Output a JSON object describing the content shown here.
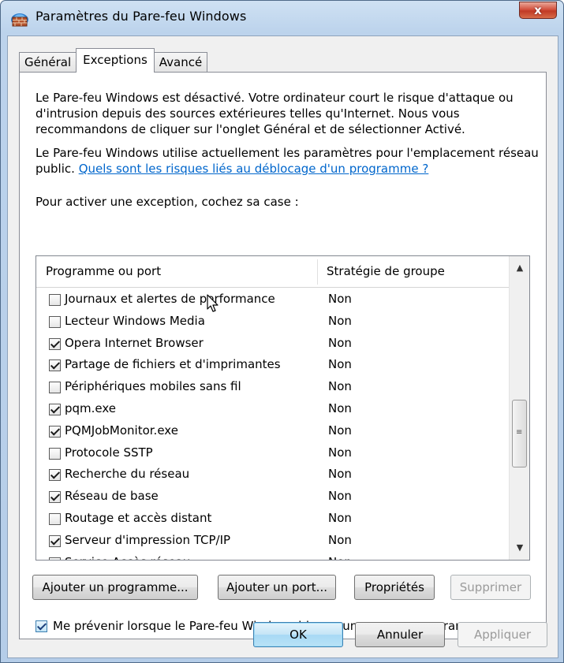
{
  "window": {
    "title": "Paramètres du Pare-feu Windows",
    "close_label": "x"
  },
  "tabs": [
    {
      "label": "Général",
      "active": false
    },
    {
      "label": "Exceptions",
      "active": true
    },
    {
      "label": "Avancé",
      "active": false
    }
  ],
  "info": {
    "warning": "Le Pare-feu Windows est désactivé. Votre ordinateur court le risque d'attaque ou d'intrusion depuis des sources extérieures telles qu'Internet. Nous vous recommandons de cliquer sur l'onglet Général et de sélectionner Activé.",
    "location_text": "Le Pare-feu Windows utilise actuellement les paramètres pour l'emplacement réseau public.",
    "risk_link": "Quels sont les risques liés au déblocage d'un programme ?",
    "instruction": "Pour activer une exception, cochez sa case :"
  },
  "list": {
    "col_program": "Programme ou port",
    "col_policy": "Stratégie de groupe",
    "rows": [
      {
        "label": "Journaux et alertes de performance",
        "checked": false,
        "policy": "Non"
      },
      {
        "label": "Lecteur Windows Media",
        "checked": false,
        "policy": "Non"
      },
      {
        "label": "Opera Internet Browser",
        "checked": true,
        "policy": "Non"
      },
      {
        "label": "Partage de fichiers et d'imprimantes",
        "checked": true,
        "policy": "Non"
      },
      {
        "label": "Périphériques mobiles sans fil",
        "checked": false,
        "policy": "Non"
      },
      {
        "label": "pqm.exe",
        "checked": true,
        "policy": "Non"
      },
      {
        "label": "PQMJobMonitor.exe",
        "checked": true,
        "policy": "Non"
      },
      {
        "label": "Protocole SSTP",
        "checked": false,
        "policy": "Non"
      },
      {
        "label": "Recherche du réseau",
        "checked": true,
        "policy": "Non"
      },
      {
        "label": "Réseau de base",
        "checked": true,
        "policy": "Non"
      },
      {
        "label": "Routage et accès distant",
        "checked": false,
        "policy": "Non"
      },
      {
        "label": "Serveur d'impression TCP/IP",
        "checked": true,
        "policy": "Non"
      },
      {
        "label": "Service Accès réseau",
        "checked": true,
        "policy": "Non"
      }
    ]
  },
  "actions": {
    "add_program": "Ajouter un programme...",
    "add_port": "Ajouter un port...",
    "properties": "Propriétés",
    "delete": "Supprimer"
  },
  "notify": {
    "label": "Me prévenir lorsque le Pare-feu Windows bloque un nouveau programme",
    "checked": true
  },
  "footer": {
    "ok": "OK",
    "cancel": "Annuler",
    "apply": "Appliquer"
  }
}
